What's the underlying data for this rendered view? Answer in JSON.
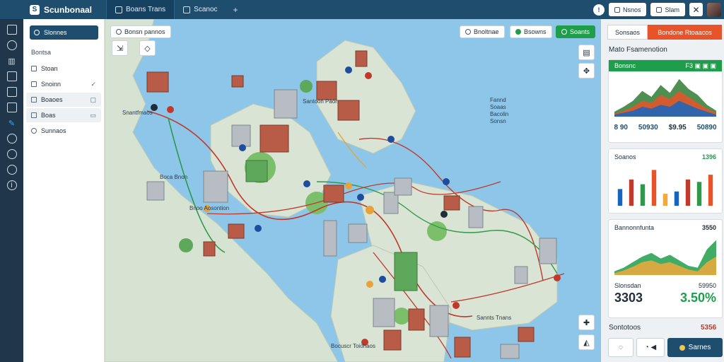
{
  "app": {
    "title": "Scunbonaal"
  },
  "top_tabs": [
    {
      "label": "Boans Trans",
      "icon": "map-icon",
      "active": true
    },
    {
      "label": "Scanoc",
      "icon": "monitor-icon",
      "active": false
    }
  ],
  "top_right": {
    "status": "!",
    "buttons": [
      {
        "label": "Nsnos",
        "icon": "doc-icon"
      },
      {
        "label": "Slam",
        "icon": "doc-icon"
      }
    ]
  },
  "left_panel": {
    "header": "Slonnes",
    "section": "Bontsa",
    "items": [
      {
        "label": "Stoan",
        "icon": "doc-icon",
        "end": ""
      },
      {
        "label": "Snoinn",
        "icon": "doc-icon",
        "end": "✓"
      },
      {
        "label": "Boaoes",
        "icon": "doc-icon",
        "end": "▢"
      },
      {
        "label": "Boas",
        "icon": "doc-icon",
        "end": "▭"
      },
      {
        "label": "Sunnaos",
        "icon": "clock-icon",
        "end": ""
      }
    ]
  },
  "map": {
    "search_label": "Bonsn pannos",
    "chips": [
      {
        "label": "Bnoltnae",
        "icon": "target-icon"
      },
      {
        "label": "Bsowns",
        "icon": "green-dot-icon"
      },
      {
        "label": "Soants",
        "icon": "gear-icon"
      }
    ],
    "labels": [
      "Snantfmaos",
      "Boca Bnon",
      "Santoon Paon",
      "Fannd Soaas Bacolin Sonsn",
      "Bnoo Aosontion",
      "Sannts Tnans",
      "Bocuscr Toiohaos"
    ]
  },
  "right_panel": {
    "tabs": [
      "Sonsaos",
      "Bondone Rtoaacos"
    ],
    "title": "Mato Fsamenotion",
    "card1": {
      "header": "Bonsnc",
      "header_right": "F3 ▣ ▣ ▣",
      "stats": [
        "8 90",
        "50930",
        "$9.95",
        "50890"
      ]
    },
    "card2": {
      "title": "Soanos",
      "value": "1396"
    },
    "card3": {
      "title": "Bannonnfunta",
      "value": "3550",
      "left_label": "Slonsdan",
      "right_label": "59950",
      "big_value": "3303",
      "big_pct": "3.50%"
    },
    "footer_label": "Sontotoos",
    "footer_value": "5356",
    "action_label": "Sarnes"
  },
  "colors": {
    "header": "#1f4d6e",
    "accent_green": "#1e9e4a",
    "accent_orange": "#e8542a",
    "water": "#8ec6ea",
    "land": "#d4dfd0"
  },
  "chart_data": [
    {
      "type": "area",
      "series": [
        {
          "values": [
            5,
            10,
            16,
            26,
            20,
            32,
            24,
            38,
            28,
            22,
            12,
            6
          ]
        },
        {
          "values": [
            3,
            6,
            10,
            16,
            14,
            22,
            18,
            26,
            20,
            14,
            8,
            4
          ]
        },
        {
          "values": [
            2,
            4,
            6,
            10,
            8,
            12,
            10,
            16,
            12,
            8,
            5,
            2
          ]
        }
      ],
      "ylim": [
        0,
        40
      ]
    },
    {
      "type": "bar",
      "series": [
        {
          "values": [
            14,
            22,
            18,
            30,
            10,
            12,
            22,
            20,
            26
          ]
        }
      ],
      "ylim": [
        0,
        32
      ]
    },
    {
      "type": "area",
      "series": [
        {
          "values": [
            4,
            8,
            14,
            20,
            24,
            18,
            22,
            16,
            10,
            8,
            28,
            38
          ]
        },
        {
          "values": [
            2,
            5,
            9,
            14,
            16,
            12,
            14,
            10,
            6,
            4,
            14,
            20
          ]
        }
      ],
      "ylim": [
        0,
        40
      ]
    }
  ]
}
